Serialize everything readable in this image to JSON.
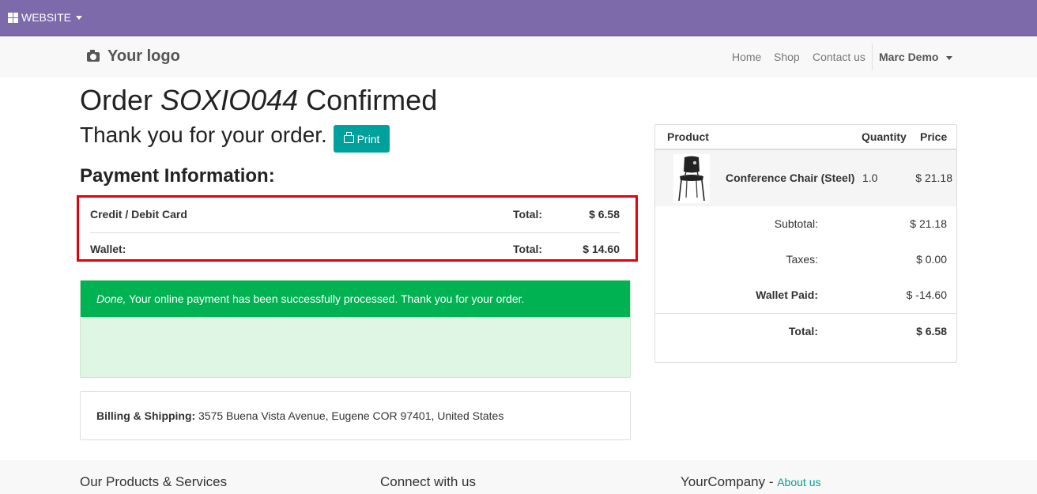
{
  "topbar": {
    "website_label": "WEBSITE"
  },
  "navbar": {
    "logo_text": "Your logo",
    "links": {
      "home": "Home",
      "shop": "Shop",
      "contact": "Contact us"
    },
    "user": "Marc Demo"
  },
  "order": {
    "title_prefix": "Order",
    "reference": "SOXIO044",
    "title_suffix": "Confirmed",
    "thanks": "Thank you for your order.",
    "print_label": "Print"
  },
  "payment": {
    "heading": "Payment Information:",
    "rows": [
      {
        "method": "Credit / Debit Card",
        "total_label": "Total:",
        "amount": "$ 6.58"
      },
      {
        "method": "Wallet:",
        "total_label": "Total:",
        "amount": "$ 14.60"
      }
    ]
  },
  "alert": {
    "emphasis": "Done,",
    "message": " Your online payment has been successfully processed. Thank you for your order."
  },
  "billing": {
    "label": "Billing & Shipping:",
    "address": "3575 Buena Vista Avenue, Eugene COR 97401, United States"
  },
  "summary": {
    "headers": {
      "product": "Product",
      "quantity": "Quantity",
      "price": "Price"
    },
    "item": {
      "name": "Conference Chair (Steel)",
      "quantity": "1.0",
      "price": "$ 21.18"
    },
    "subtotal": {
      "label": "Subtotal:",
      "value": "$ 21.18"
    },
    "taxes": {
      "label": "Taxes:",
      "value": "$ 0.00"
    },
    "wallet": {
      "label": "Wallet Paid:",
      "value": "$ -14.60"
    },
    "total": {
      "label": "Total:",
      "value": "$ 6.58"
    }
  },
  "footer": {
    "col1": "Our Products & Services",
    "col2": "Connect with us",
    "col3_company": "YourCompany",
    "col3_sep": " - ",
    "col3_link": "About us"
  },
  "colors": {
    "admin_bar": "#7c6aab",
    "primary": "#00a09d",
    "success": "#00b252",
    "highlight": "#e4000b"
  }
}
